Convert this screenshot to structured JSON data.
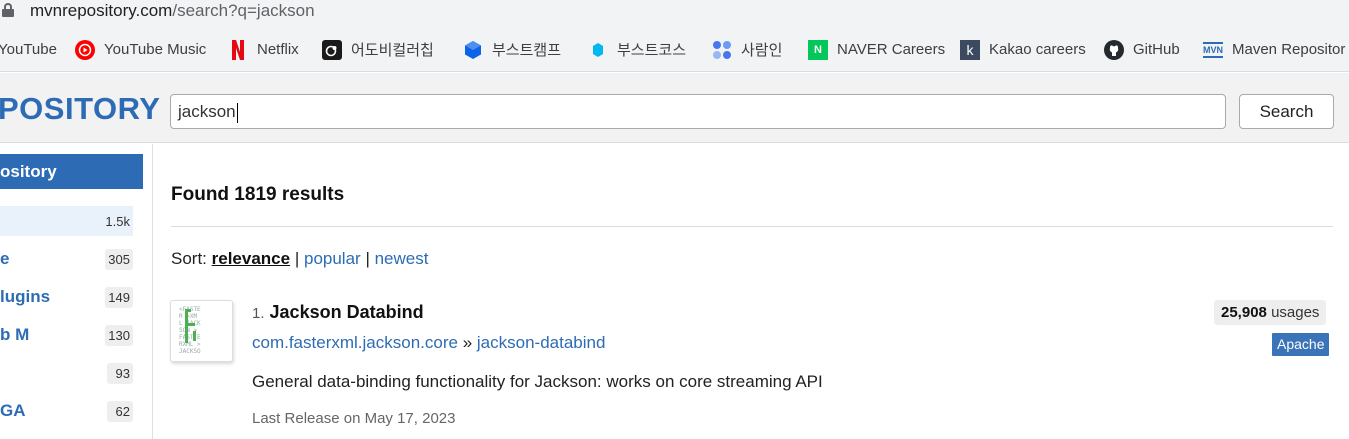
{
  "address_bar": {
    "host": "mvnrepository.com",
    "path": "/search?q=jackson",
    "lock_icon": "lock-icon"
  },
  "bookmarks": [
    {
      "label": "YouTube",
      "icon": "youtube-icon",
      "color": "#ff0000"
    },
    {
      "label": "YouTube Music",
      "icon": "youtube-music-icon",
      "color": "#ff0000"
    },
    {
      "label": "Netflix",
      "icon": "netflix-icon",
      "color": "#e50914"
    },
    {
      "label": "어도비컬러칩",
      "icon": "adobe-color-icon",
      "color": "#1a1a1a"
    },
    {
      "label": "부스트캠프",
      "icon": "boostcamp-icon",
      "color": "#0b63e5"
    },
    {
      "label": "부스트코스",
      "icon": "boostcourse-icon",
      "color": "#00b7f1"
    },
    {
      "label": "사람인",
      "icon": "saramin-icon",
      "color": "#4876ef"
    },
    {
      "label": "NAVER Careers",
      "icon": "naver-icon",
      "color": "#03c75a"
    },
    {
      "label": "Kakao careers",
      "icon": "kakao-icon",
      "color": "#3c4a5f"
    },
    {
      "label": "GitHub",
      "icon": "github-icon",
      "color": "#24292f"
    },
    {
      "label": "Maven Repositor",
      "icon": "mvn-icon",
      "color": "#2d6cb5"
    }
  ],
  "header": {
    "logo": "POSITORY",
    "search_value": "jackson",
    "search_button": "Search"
  },
  "sidebar": {
    "heading": "ository",
    "items": [
      {
        "label": "",
        "count": "1.5k"
      },
      {
        "label": "e",
        "count": "305"
      },
      {
        "label": "lugins",
        "count": "149"
      },
      {
        "label": "b M",
        "count": "130"
      },
      {
        "label": "",
        "count": "93"
      },
      {
        "label": "GA",
        "count": "62"
      }
    ]
  },
  "main": {
    "found": "Found 1819 results",
    "sort_label": "Sort:",
    "sort_options": [
      "relevance",
      "popular",
      "newest"
    ],
    "result": {
      "index": "1.",
      "name": "Jackson Databind",
      "group": "com.fasterxml.jackson.core",
      "separator": "»",
      "artifact": "jackson-databind",
      "usages_count": "25,908",
      "usages_label": "usages",
      "license": "Apache",
      "description": "General data-binding functionality for Jackson: works on core streaming API",
      "release": "Last Release on May 17, 2023"
    }
  }
}
